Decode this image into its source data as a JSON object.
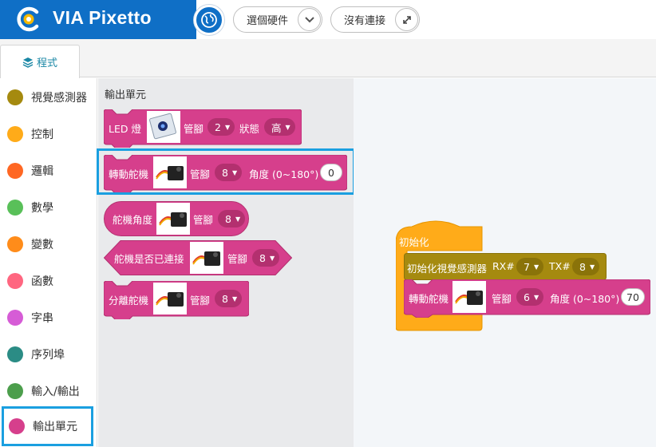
{
  "header": {
    "app_name": "VIA Pixetto",
    "hardware_select_label": "選個硬件",
    "connection_label": "沒有連接",
    "brand_color": "#0f6fc6"
  },
  "tabs": [
    {
      "label": "程式",
      "icon": "layers-icon",
      "active": true
    }
  ],
  "categories": [
    {
      "label": "視覺感測器",
      "color": "#a58a0f"
    },
    {
      "label": "控制",
      "color": "#ffab19"
    },
    {
      "label": "邏輯",
      "color": "#ff6723"
    },
    {
      "label": "數學",
      "color": "#59c059"
    },
    {
      "label": "變數",
      "color": "#ff8c1a"
    },
    {
      "label": "函數",
      "color": "#ff6680"
    },
    {
      "label": "字串",
      "color": "#d65cd6"
    },
    {
      "label": "序列埠",
      "color": "#2b8c85"
    },
    {
      "label": "輸入/輸出",
      "color": "#4c9e4c"
    },
    {
      "label": "輸出單元",
      "color": "#d63f8c",
      "selected": true
    }
  ],
  "flyout": {
    "title": "輸出單元",
    "block_color": "#d63f8c",
    "block_dark_color": "#b3306f",
    "blocks": {
      "led": {
        "label": "LED 燈",
        "pin_label": "管腳",
        "pin_value": "2",
        "state_label": "狀態",
        "state_value": "高"
      },
      "servo_rotate": {
        "label": "轉動舵機",
        "pin_label": "管腳",
        "pin_value": "8",
        "angle_label": "角度 (0~180°)",
        "angle_value": "0"
      },
      "servo_angle": {
        "label": "舵機角度",
        "pin_label": "管腳",
        "pin_value": "8"
      },
      "servo_connected": {
        "label": "舵機是否已連接",
        "pin_label": "管腳",
        "pin_value": "8"
      },
      "servo_detach": {
        "label": "分離舵機",
        "pin_label": "管腳",
        "pin_value": "8"
      }
    }
  },
  "workspace": {
    "init_block": {
      "label": "初始化",
      "color": "#ffab19"
    },
    "vision_init": {
      "label": "初始化視覺感測器",
      "rx_label": "RX#",
      "rx_value": "7",
      "tx_label": "TX#",
      "tx_value": "8",
      "color": "#a58a0f"
    },
    "servo_rotate": {
      "label": "轉動舵機",
      "pin_label": "管腳",
      "pin_value": "6",
      "angle_label": "角度 (0~180°)",
      "angle_value": "70",
      "color": "#d63f8c"
    }
  }
}
